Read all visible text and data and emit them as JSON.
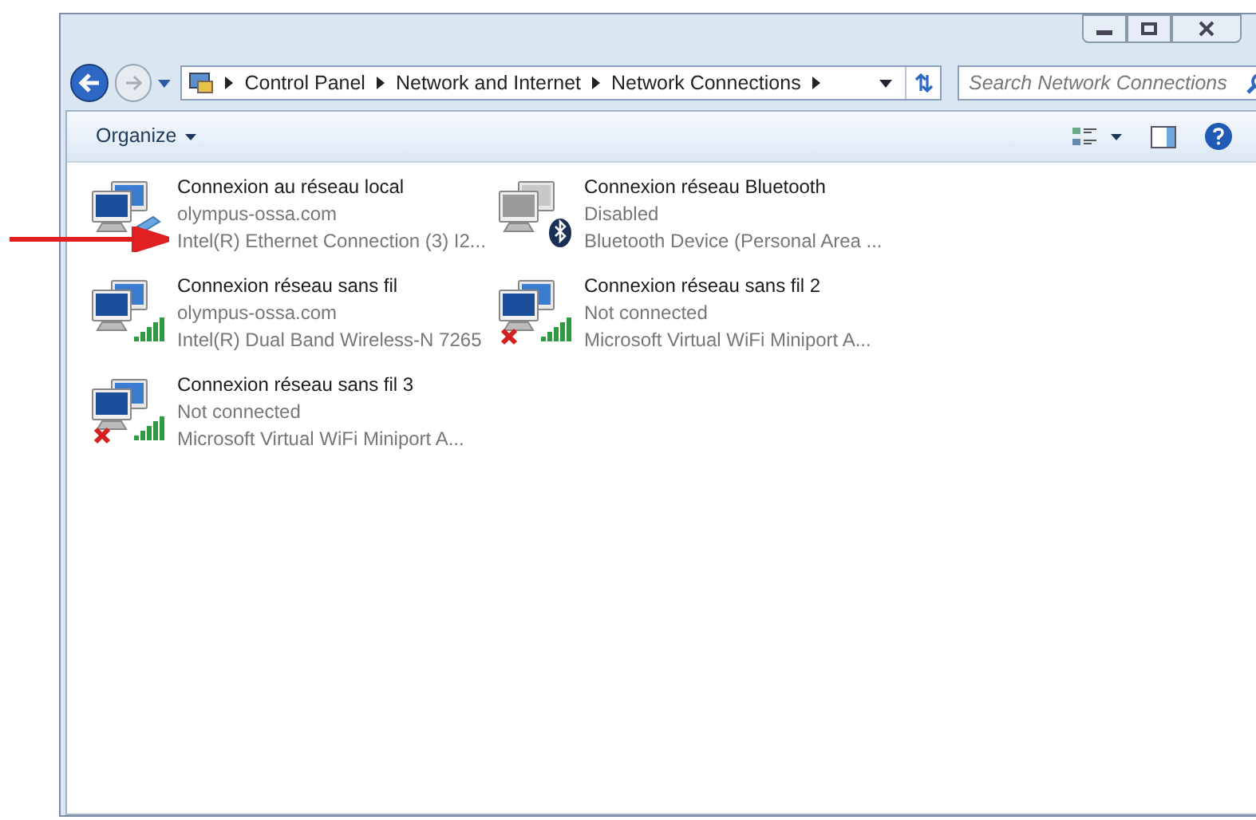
{
  "address_bar": {
    "breadcrumbs": [
      "Control Panel",
      "Network and Internet",
      "Network Connections"
    ]
  },
  "search": {
    "placeholder": "Search Network Connections"
  },
  "toolbar": {
    "organize": "Organize"
  },
  "connections": [
    {
      "name": "Connexion au réseau local",
      "status": "olympus-ossa.com",
      "device": "Intel(R) Ethernet Connection (3) I2...",
      "kind": "wired",
      "connected": true,
      "disabled": false
    },
    {
      "name": "Connexion réseau Bluetooth",
      "status": "Disabled",
      "device": "Bluetooth Device (Personal Area ...",
      "kind": "bluetooth",
      "connected": true,
      "disabled": true
    },
    {
      "name": "Connexion réseau sans fil",
      "status": "olympus-ossa.com",
      "device": "Intel(R) Dual Band Wireless-N 7265",
      "kind": "wireless",
      "connected": true,
      "disabled": false
    },
    {
      "name": "Connexion réseau sans fil 2",
      "status": "Not connected",
      "device": "Microsoft Virtual WiFi Miniport A...",
      "kind": "wireless",
      "connected": false,
      "disabled": false
    },
    {
      "name": "Connexion réseau sans fil 3",
      "status": "Not connected",
      "device": "Microsoft Virtual WiFi Miniport A...",
      "kind": "wireless",
      "connected": false,
      "disabled": false
    }
  ]
}
